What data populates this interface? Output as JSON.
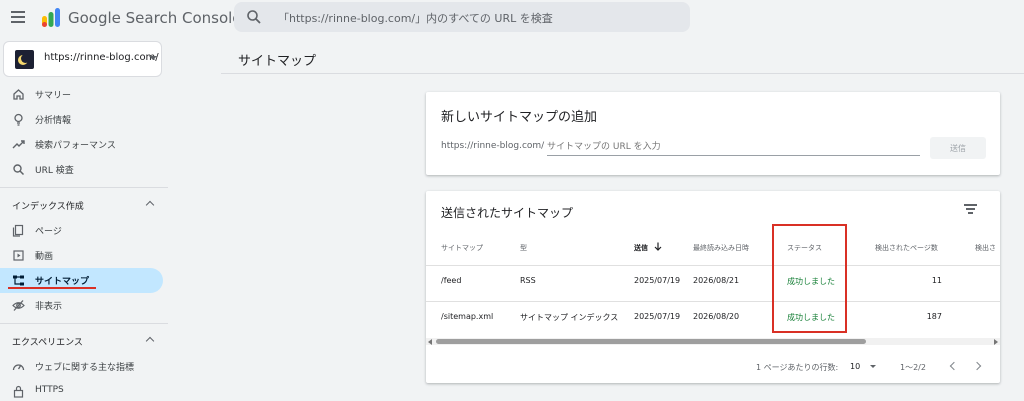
{
  "header": {
    "brand": "Google Search Console",
    "search_placeholder": "「https://rinne-blog.com/」内のすべての URL を検査"
  },
  "sidebar": {
    "property": "https://rinne-blog.com/",
    "items_top": [
      {
        "label": "サマリー",
        "icon": "home-icon"
      },
      {
        "label": "分析情報",
        "icon": "lightbulb-icon"
      },
      {
        "label": "検索パフォーマンス",
        "icon": "trending-up-icon"
      },
      {
        "label": "URL 検査",
        "icon": "search-icon"
      }
    ],
    "section_index": "インデックス作成",
    "items_index": [
      {
        "label": "ページ",
        "icon": "pages-icon"
      },
      {
        "label": "動画",
        "icon": "video-icon"
      },
      {
        "label": "サイトマップ",
        "icon": "sitemap-icon",
        "active": true
      },
      {
        "label": "非表示",
        "icon": "visibility-off-icon"
      }
    ],
    "section_experience": "エクスペリエンス",
    "items_experience": [
      {
        "label": "ウェブに関する主な指標",
        "icon": "speed-icon"
      },
      {
        "label": "HTTPS",
        "icon": "lock-icon"
      }
    ]
  },
  "main": {
    "page_title": "サイトマップ",
    "add_card": {
      "title": "新しいサイトマップの追加",
      "prefix": "https://rinne-blog.com/",
      "input_placeholder": "サイトマップの URL を入力",
      "submit_label": "送信"
    },
    "submitted_card": {
      "title": "送信されたサイトマップ",
      "columns": [
        "サイトマップ",
        "型",
        "送信",
        "最終読み込み日時",
        "ステータス",
        "検出されたページ数",
        "検出さ"
      ],
      "rows": [
        {
          "sitemap": "/feed",
          "type": "RSS",
          "submitted": "2025/07/19",
          "last_read": "2026/08/21",
          "status": "成功しました",
          "pages": "11"
        },
        {
          "sitemap": "/sitemap.xml",
          "type": "サイトマップ インデックス",
          "submitted": "2025/07/19",
          "last_read": "2026/08/20",
          "status": "成功しました",
          "pages": "187"
        }
      ],
      "pager": {
        "rows_per_page_label": "1 ページあたりの行数:",
        "rows_per_page": "10",
        "range": "1～2/2"
      }
    }
  },
  "colors": {
    "active_nav": "#c2e7ff",
    "success": "#188038",
    "highlight": "#d93025"
  }
}
